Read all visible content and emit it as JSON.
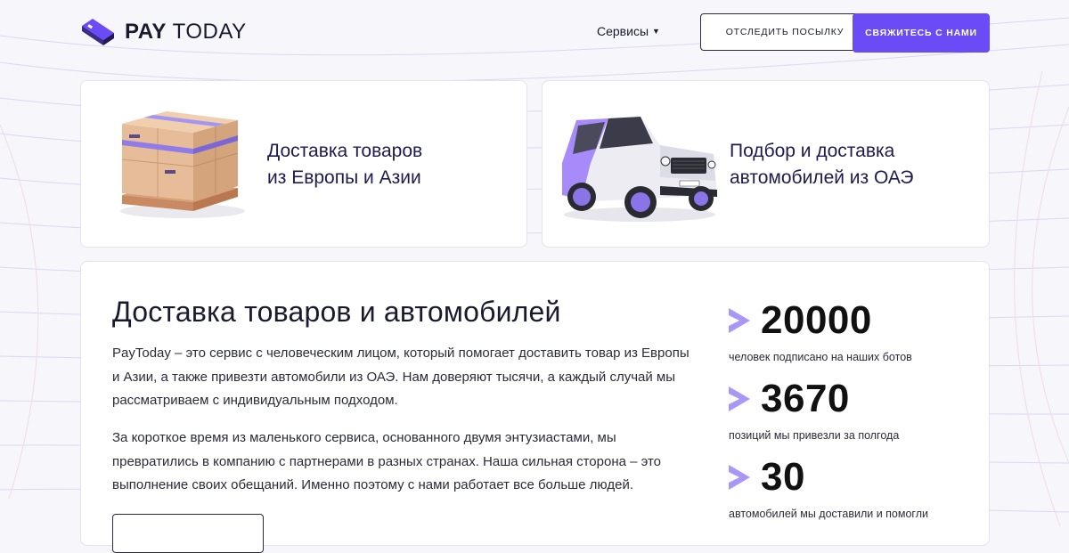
{
  "header": {
    "logo_bold": "PAY",
    "logo_light": "TODAY",
    "services_label": "Сервисы",
    "track_button": "ОТСЛЕДИТЬ ПОСЫЛКУ",
    "contact_button": "СВЯЖИТЕСЬ С НАМИ"
  },
  "services": [
    {
      "title_line1": "Доставка товаров",
      "title_line2": "из Европы и Азии",
      "image": "pallet-boxes-image"
    },
    {
      "title_line1": "Подбор и доставка",
      "title_line2": "автомобилей из ОАЭ",
      "image": "suv-car-image"
    }
  ],
  "about": {
    "heading": "Доставка товаров и автомобилей",
    "paragraph1": "PayToday – это сервис с человеческим лицом, который помогает доставить товар из Европы и Азии, а также привезти автомобили из ОАЭ. Нам доверяют тысячи, а каждый случай мы рассматриваем с индивидуальным подходом.",
    "paragraph2": "За короткое время из маленького сервиса, основанного двумя энтузиастами, мы превратились в компанию с партнерами в разных странах. Наша сильная сторона – это выполнение своих обещаний. Именно поэтому с нами работает все больше людей."
  },
  "stats": [
    {
      "value": "20000",
      "label": "человек подписано на наших ботов"
    },
    {
      "value": "3670",
      "label": "позиций мы привезли за полгода"
    },
    {
      "value": "30",
      "label": "автомобилей мы доставили и помогли"
    }
  ],
  "colors": {
    "accent": "#6a4bf5",
    "chevron": "#a996f7",
    "background": "#f6f6fb",
    "card_title": "#1f1b4d"
  }
}
